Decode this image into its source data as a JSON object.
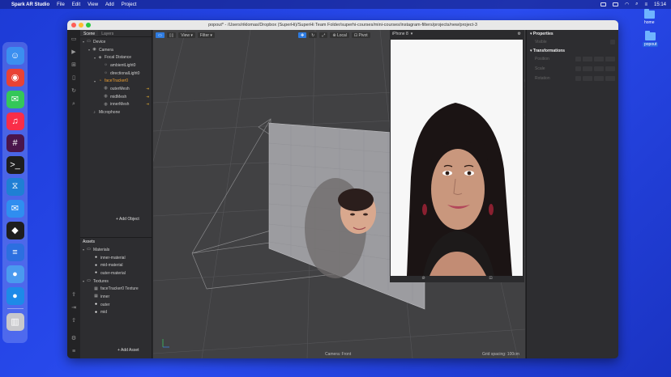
{
  "menubar": {
    "app_name": "Spark AR Studio",
    "items": [
      "File",
      "Edit",
      "View",
      "Add",
      "Project"
    ],
    "clock": "15:14"
  },
  "desktop": {
    "icons": [
      {
        "label": "home",
        "selected": false
      },
      {
        "label": "popout",
        "selected": true
      }
    ]
  },
  "dock": {
    "apps": [
      {
        "name": "finder-icon",
        "color": "#3b8ff0",
        "glyph": "☺"
      },
      {
        "name": "chrome-icon",
        "color": "#e94235",
        "glyph": "◉"
      },
      {
        "name": "messages-icon",
        "color": "#34c759",
        "glyph": "✉"
      },
      {
        "name": "music-icon",
        "color": "#fa2d48",
        "glyph": "♫"
      },
      {
        "name": "slack-icon",
        "color": "#4a154b",
        "glyph": "#"
      },
      {
        "name": "terminal-icon",
        "color": "#1e1e1e",
        "glyph": ">_"
      },
      {
        "name": "vscode-icon",
        "color": "#1f7fd4",
        "glyph": "⧖"
      },
      {
        "name": "mail-icon",
        "color": "#2f8ef0",
        "glyph": "✉"
      },
      {
        "name": "figma-icon",
        "color": "#1e1e1e",
        "glyph": "◆"
      },
      {
        "name": "layers-app-icon",
        "color": "#2c6fe0",
        "glyph": "≡"
      },
      {
        "name": "game-icon",
        "color": "#4a9aef",
        "glyph": "●"
      },
      {
        "name": "bird-icon",
        "color": "#1d8ae8",
        "glyph": "●"
      },
      {
        "name": "trash-icon",
        "color": "#c8c8cc",
        "glyph": "▥"
      }
    ]
  },
  "window": {
    "title": "popout* - /Users/riklomas/Dropbox (SuperHi)/SuperHi Team Folder/superhi-courses/mini-courses/instagram-filters/projects/new/project-3"
  },
  "scene_panel": {
    "tabs": [
      "Scene",
      "Layers"
    ],
    "tree": [
      {
        "label": "Device",
        "indent": 0,
        "icon": "device-icon",
        "orange": false,
        "flag": ""
      },
      {
        "label": "Camera",
        "indent": 1,
        "icon": "camera-icon",
        "orange": false,
        "flag": ""
      },
      {
        "label": "Focal Distance",
        "indent": 2,
        "icon": "focal-icon",
        "orange": false,
        "flag": ""
      },
      {
        "label": "ambientLight0",
        "indent": 3,
        "icon": "light-icon",
        "orange": false,
        "flag": ""
      },
      {
        "label": "directionalLight0",
        "indent": 3,
        "icon": "light-icon",
        "orange": false,
        "flag": ""
      },
      {
        "label": "faceTracker0",
        "indent": 2,
        "icon": "face-tracker-icon",
        "orange": true,
        "flag": ""
      },
      {
        "label": "outerMesh",
        "indent": 3,
        "icon": "mesh-icon",
        "orange": false,
        "flag": "⇥"
      },
      {
        "label": "midMesh",
        "indent": 3,
        "icon": "mesh-icon",
        "orange": false,
        "flag": "⇥"
      },
      {
        "label": "innerMesh",
        "indent": 3,
        "icon": "mesh-icon",
        "orange": false,
        "flag": "⇥"
      },
      {
        "label": "Microphone",
        "indent": 1,
        "icon": "microphone-icon",
        "orange": false,
        "flag": ""
      }
    ],
    "add_object": "+ Add Object",
    "assets_title": "Assets",
    "assets": [
      {
        "label": "Materials",
        "indent": 0,
        "icon": "folder-icon"
      },
      {
        "label": "inner-material",
        "indent": 1,
        "icon": "material-icon"
      },
      {
        "label": "mid-material",
        "indent": 1,
        "icon": "material-icon"
      },
      {
        "label": "outer-material",
        "indent": 1,
        "icon": "material-icon"
      },
      {
        "label": "Textures",
        "indent": 0,
        "icon": "folder-icon"
      },
      {
        "label": "faceTracker0 Texture",
        "indent": 1,
        "icon": "texture-icon"
      },
      {
        "label": "inner",
        "indent": 1,
        "icon": "texture-icon"
      },
      {
        "label": "outer",
        "indent": 1,
        "icon": "circle-icon"
      },
      {
        "label": "mid",
        "indent": 1,
        "icon": "circle-icon"
      }
    ],
    "add_asset": "+ Add Asset"
  },
  "viewport": {
    "view_label": "View",
    "filter_label": "Filter",
    "local_label": "Local",
    "pivot_label": "Pivot",
    "camera_label": "Camera: Front",
    "grid_label": "Grid spacing: 100cm"
  },
  "simulator": {
    "device": "iPhone 8"
  },
  "properties": {
    "title": "Properties",
    "visible_label": "Visible",
    "transformations_title": "Transformations",
    "rows": [
      "Position",
      "Scale",
      "Rotation"
    ]
  }
}
